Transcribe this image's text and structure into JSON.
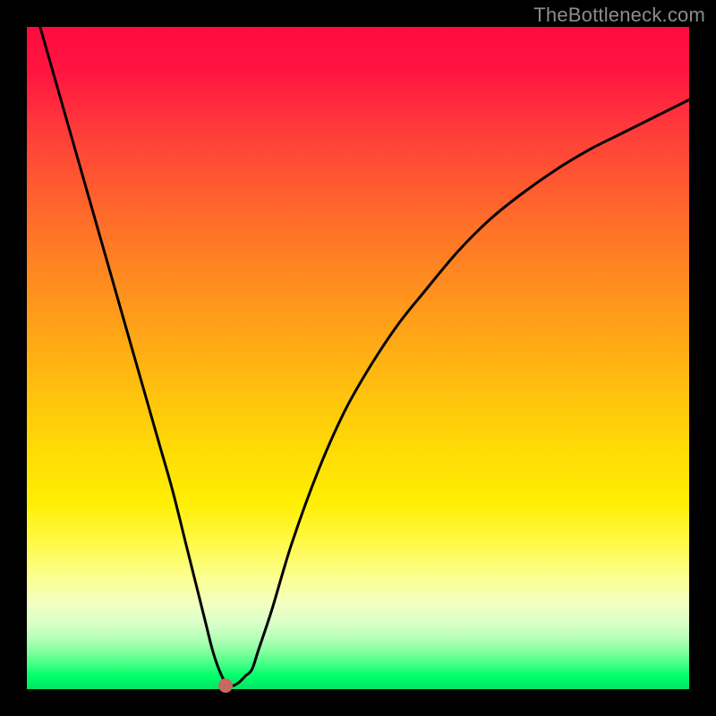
{
  "watermark": "TheBottleneck.com",
  "chart_data": {
    "type": "line",
    "title": "",
    "xlabel": "",
    "ylabel": "",
    "xlim": [
      0,
      100
    ],
    "ylim": [
      0,
      100
    ],
    "grid": false,
    "legend": false,
    "series": [
      {
        "name": "bottleneck-curve",
        "x": [
          0,
          2,
          4,
          6,
          8,
          10,
          12,
          14,
          16,
          18,
          20,
          22,
          24,
          26,
          27,
          28,
          29,
          30,
          31,
          32,
          33,
          34,
          35,
          37,
          40,
          44,
          48,
          52,
          56,
          60,
          65,
          70,
          75,
          80,
          85,
          90,
          95,
          100
        ],
        "y": [
          107,
          100,
          93,
          86,
          79,
          72,
          65,
          58,
          51,
          44,
          37,
          30,
          22,
          14,
          10,
          6,
          3,
          1,
          0.5,
          1,
          2,
          3,
          6,
          12,
          22,
          33,
          42,
          49,
          55,
          60,
          66,
          71,
          75,
          78.5,
          81.5,
          84,
          86.5,
          89
        ]
      }
    ],
    "marker": {
      "x": 30,
      "y": 0.5
    },
    "colors": {
      "curve": "#000000",
      "marker": "#c46a60",
      "gradient_top": "#ff0a3e",
      "gradient_bottom": "#00e663"
    }
  }
}
